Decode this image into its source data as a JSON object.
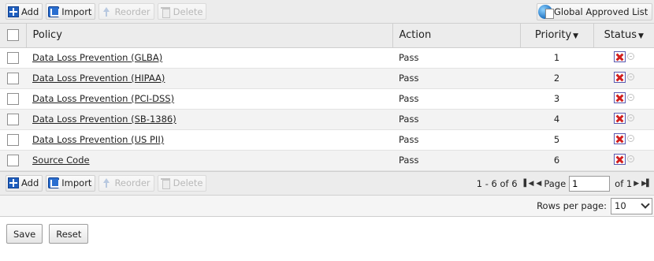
{
  "toolbar": {
    "add_label": "Add",
    "import_label": "Import",
    "reorder_label": "Reorder",
    "delete_label": "Delete",
    "global_approved_label": "Global Approved List"
  },
  "table": {
    "headers": {
      "policy": "Policy",
      "action": "Action",
      "priority": "Priority",
      "status": "Status"
    },
    "rows": [
      {
        "policy": "Data Loss Prevention (GLBA)",
        "action": "Pass",
        "priority": "1"
      },
      {
        "policy": "Data Loss Prevention (HIPAA)",
        "action": "Pass",
        "priority": "2"
      },
      {
        "policy": "Data Loss Prevention (PCI-DSS)",
        "action": "Pass",
        "priority": "3"
      },
      {
        "policy": "Data Loss Prevention (SB-1386)",
        "action": "Pass",
        "priority": "4"
      },
      {
        "policy": "Data Loss Prevention (US PII)",
        "action": "Pass",
        "priority": "5"
      },
      {
        "policy": "Source Code",
        "action": "Pass",
        "priority": "6"
      }
    ]
  },
  "pager": {
    "range_text": "1 - 6 of 6",
    "page_label": "Page",
    "page_value": "1",
    "of_text": "of 1",
    "rows_per_page_label": "Rows per page:",
    "rows_per_page_value": "10"
  },
  "footer": {
    "save_label": "Save",
    "reset_label": "Reset"
  },
  "colors": {
    "toolbar_bg": "#ececec",
    "status_x": "#d11e1e",
    "icon_blue": "#1f5fbf"
  }
}
